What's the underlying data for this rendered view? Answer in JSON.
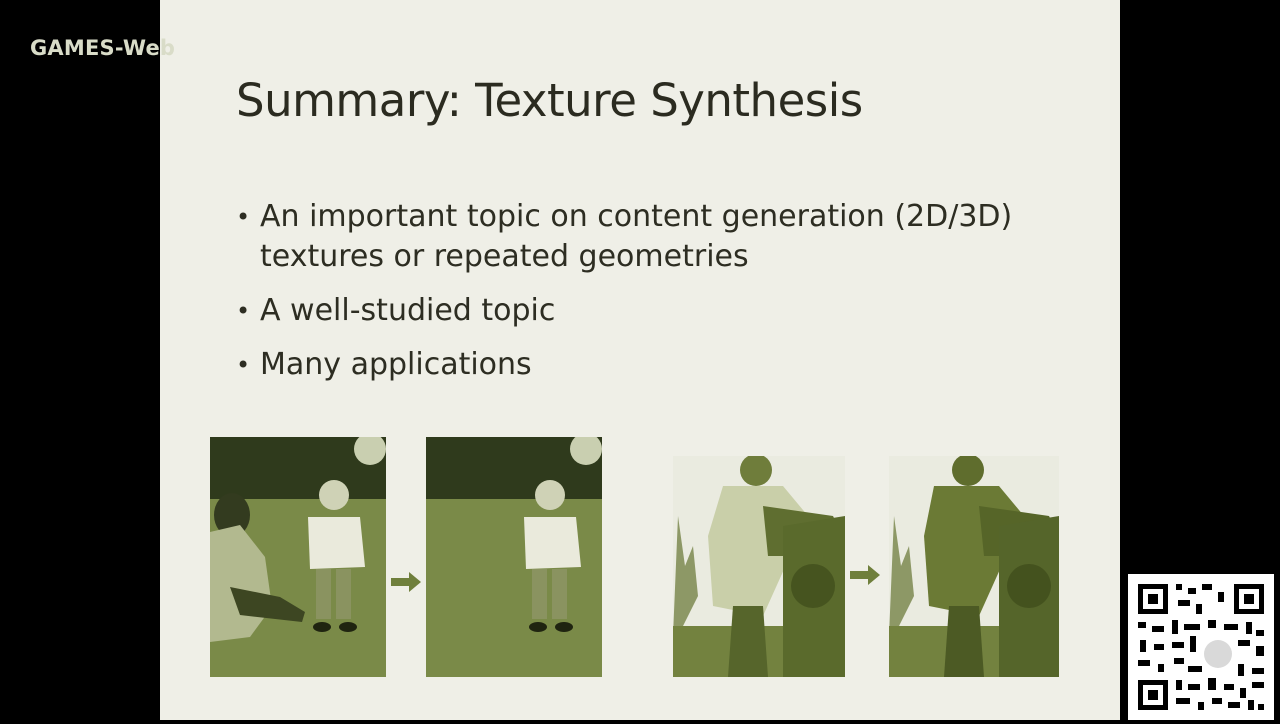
{
  "watermark": "GAMES-Web",
  "slide": {
    "title": "Summary: Texture Synthesis",
    "bullets": [
      "An important topic on content generation (2D/3D) textures or repeated geometries",
      "A well-studied topic",
      "Many applications"
    ]
  },
  "colors": {
    "background": "#000000",
    "slide_bg": "#efefe7",
    "image_tint": "#7c8b4a",
    "arrow": "#6f7f3c"
  },
  "icons": {
    "arrow_left": "arrow-right-icon",
    "arrow_right": "arrow-right-icon",
    "qr": "qr-code-icon"
  }
}
